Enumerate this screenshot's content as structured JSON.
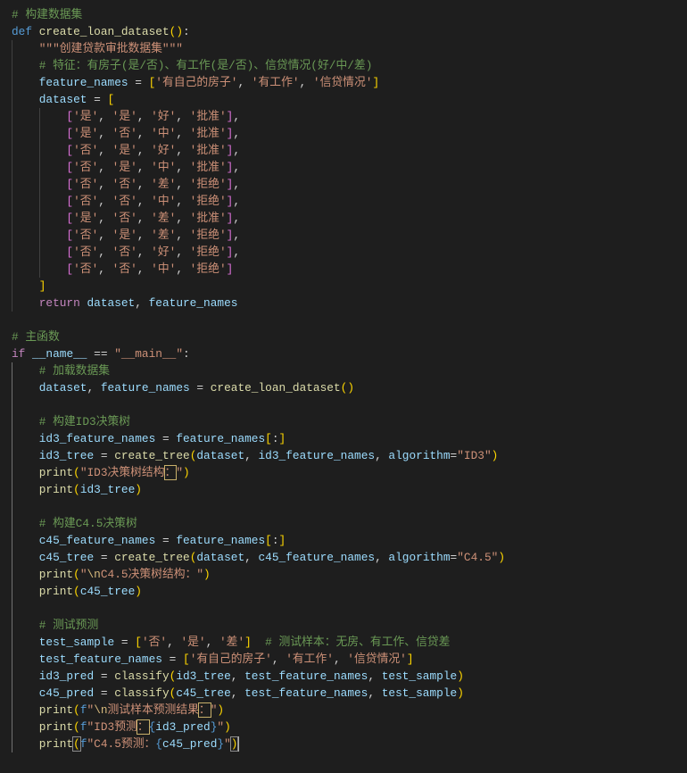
{
  "theme": {
    "background": "#1e1e1e",
    "indent_guide": "#404040",
    "indent_guide_active": "#707070",
    "cursor": "#aeafad"
  },
  "code": {
    "cursor_line": 44,
    "lines": [
      [
        [
          "# 构建数据集",
          "#6a9955"
        ]
      ],
      [
        [
          "def ",
          "#569cd6"
        ],
        [
          "create_loan_dataset",
          "#dcdcaa"
        ],
        [
          "(",
          "#ffd700"
        ],
        [
          ")",
          "#ffd700"
        ],
        [
          ":",
          "#d4d4d4"
        ]
      ],
      [
        [
          "    \"\"\"创建贷款审批数据集\"\"\"",
          "#ce9178"
        ]
      ],
      [
        [
          "    # 特征：有房子(是/否)、有工作(是/否)、信贷情况(好/中/差)",
          "#6a9955"
        ]
      ],
      [
        [
          "    feature_names",
          "#9cdcfe"
        ],
        [
          " = ",
          "#d4d4d4"
        ],
        [
          "[",
          "#ffd700"
        ],
        [
          "'有自己的房子'",
          "#ce9178"
        ],
        [
          ", ",
          "#d4d4d4"
        ],
        [
          "'有工作'",
          "#ce9178"
        ],
        [
          ", ",
          "#d4d4d4"
        ],
        [
          "'信贷情况'",
          "#ce9178"
        ],
        [
          "]",
          "#ffd700"
        ]
      ],
      [
        [
          "    dataset",
          "#9cdcfe"
        ],
        [
          " = ",
          "#d4d4d4"
        ],
        [
          "[",
          "#ffd700"
        ]
      ],
      [
        [
          "        [",
          "#da70d6"
        ],
        [
          "'是'",
          "#ce9178"
        ],
        [
          ", ",
          "#d4d4d4"
        ],
        [
          "'是'",
          "#ce9178"
        ],
        [
          ", ",
          "#d4d4d4"
        ],
        [
          "'好'",
          "#ce9178"
        ],
        [
          ", ",
          "#d4d4d4"
        ],
        [
          "'批准'",
          "#ce9178"
        ],
        [
          "]",
          "#da70d6"
        ],
        [
          ",",
          "#d4d4d4"
        ]
      ],
      [
        [
          "        [",
          "#da70d6"
        ],
        [
          "'是'",
          "#ce9178"
        ],
        [
          ", ",
          "#d4d4d4"
        ],
        [
          "'否'",
          "#ce9178"
        ],
        [
          ", ",
          "#d4d4d4"
        ],
        [
          "'中'",
          "#ce9178"
        ],
        [
          ", ",
          "#d4d4d4"
        ],
        [
          "'批准'",
          "#ce9178"
        ],
        [
          "]",
          "#da70d6"
        ],
        [
          ",",
          "#d4d4d4"
        ]
      ],
      [
        [
          "        [",
          "#da70d6"
        ],
        [
          "'否'",
          "#ce9178"
        ],
        [
          ", ",
          "#d4d4d4"
        ],
        [
          "'是'",
          "#ce9178"
        ],
        [
          ", ",
          "#d4d4d4"
        ],
        [
          "'好'",
          "#ce9178"
        ],
        [
          ", ",
          "#d4d4d4"
        ],
        [
          "'批准'",
          "#ce9178"
        ],
        [
          "]",
          "#da70d6"
        ],
        [
          ",",
          "#d4d4d4"
        ]
      ],
      [
        [
          "        [",
          "#da70d6"
        ],
        [
          "'否'",
          "#ce9178"
        ],
        [
          ", ",
          "#d4d4d4"
        ],
        [
          "'是'",
          "#ce9178"
        ],
        [
          ", ",
          "#d4d4d4"
        ],
        [
          "'中'",
          "#ce9178"
        ],
        [
          ", ",
          "#d4d4d4"
        ],
        [
          "'批准'",
          "#ce9178"
        ],
        [
          "]",
          "#da70d6"
        ],
        [
          ",",
          "#d4d4d4"
        ]
      ],
      [
        [
          "        [",
          "#da70d6"
        ],
        [
          "'否'",
          "#ce9178"
        ],
        [
          ", ",
          "#d4d4d4"
        ],
        [
          "'否'",
          "#ce9178"
        ],
        [
          ", ",
          "#d4d4d4"
        ],
        [
          "'差'",
          "#ce9178"
        ],
        [
          ", ",
          "#d4d4d4"
        ],
        [
          "'拒绝'",
          "#ce9178"
        ],
        [
          "]",
          "#da70d6"
        ],
        [
          ",",
          "#d4d4d4"
        ]
      ],
      [
        [
          "        [",
          "#da70d6"
        ],
        [
          "'否'",
          "#ce9178"
        ],
        [
          ", ",
          "#d4d4d4"
        ],
        [
          "'否'",
          "#ce9178"
        ],
        [
          ", ",
          "#d4d4d4"
        ],
        [
          "'中'",
          "#ce9178"
        ],
        [
          ", ",
          "#d4d4d4"
        ],
        [
          "'拒绝'",
          "#ce9178"
        ],
        [
          "]",
          "#da70d6"
        ],
        [
          ",",
          "#d4d4d4"
        ]
      ],
      [
        [
          "        [",
          "#da70d6"
        ],
        [
          "'是'",
          "#ce9178"
        ],
        [
          ", ",
          "#d4d4d4"
        ],
        [
          "'否'",
          "#ce9178"
        ],
        [
          ", ",
          "#d4d4d4"
        ],
        [
          "'差'",
          "#ce9178"
        ],
        [
          ", ",
          "#d4d4d4"
        ],
        [
          "'批准'",
          "#ce9178"
        ],
        [
          "]",
          "#da70d6"
        ],
        [
          ",",
          "#d4d4d4"
        ]
      ],
      [
        [
          "        [",
          "#da70d6"
        ],
        [
          "'否'",
          "#ce9178"
        ],
        [
          ", ",
          "#d4d4d4"
        ],
        [
          "'是'",
          "#ce9178"
        ],
        [
          ", ",
          "#d4d4d4"
        ],
        [
          "'差'",
          "#ce9178"
        ],
        [
          ", ",
          "#d4d4d4"
        ],
        [
          "'拒绝'",
          "#ce9178"
        ],
        [
          "]",
          "#da70d6"
        ],
        [
          ",",
          "#d4d4d4"
        ]
      ],
      [
        [
          "        [",
          "#da70d6"
        ],
        [
          "'否'",
          "#ce9178"
        ],
        [
          ", ",
          "#d4d4d4"
        ],
        [
          "'否'",
          "#ce9178"
        ],
        [
          ", ",
          "#d4d4d4"
        ],
        [
          "'好'",
          "#ce9178"
        ],
        [
          ", ",
          "#d4d4d4"
        ],
        [
          "'拒绝'",
          "#ce9178"
        ],
        [
          "]",
          "#da70d6"
        ],
        [
          ",",
          "#d4d4d4"
        ]
      ],
      [
        [
          "        [",
          "#da70d6"
        ],
        [
          "'否'",
          "#ce9178"
        ],
        [
          ", ",
          "#d4d4d4"
        ],
        [
          "'否'",
          "#ce9178"
        ],
        [
          ", ",
          "#d4d4d4"
        ],
        [
          "'中'",
          "#ce9178"
        ],
        [
          ", ",
          "#d4d4d4"
        ],
        [
          "'拒绝'",
          "#ce9178"
        ],
        [
          "]",
          "#da70d6"
        ]
      ],
      [
        [
          "    ]",
          "#ffd700"
        ]
      ],
      [
        [
          "    return ",
          "#c586c0"
        ],
        [
          "dataset",
          "#9cdcfe"
        ],
        [
          ", ",
          "#d4d4d4"
        ],
        [
          "feature_names",
          "#9cdcfe"
        ]
      ],
      [],
      [
        [
          "# 主函数",
          "#6a9955"
        ]
      ],
      [
        [
          "if ",
          "#c586c0"
        ],
        [
          "__name__",
          "#9cdcfe"
        ],
        [
          " == ",
          "#d4d4d4"
        ],
        [
          "\"__main__\"",
          "#ce9178"
        ],
        [
          ":",
          "#d4d4d4"
        ]
      ],
      [
        [
          "    # 加载数据集",
          "#6a9955"
        ]
      ],
      [
        [
          "    dataset",
          "#9cdcfe"
        ],
        [
          ", ",
          "#d4d4d4"
        ],
        [
          "feature_names",
          "#9cdcfe"
        ],
        [
          " = ",
          "#d4d4d4"
        ],
        [
          "create_loan_dataset",
          "#dcdcaa"
        ],
        [
          "(",
          "#ffd700"
        ],
        [
          ")",
          "#ffd700"
        ]
      ],
      [],
      [
        [
          "    # 构建ID3决策树",
          "#6a9955"
        ]
      ],
      [
        [
          "    id3_feature_names",
          "#9cdcfe"
        ],
        [
          " = ",
          "#d4d4d4"
        ],
        [
          "feature_names",
          "#9cdcfe"
        ],
        [
          "[",
          "#ffd700"
        ],
        [
          ":",
          "#d4d4d4"
        ],
        [
          "]",
          "#ffd700"
        ]
      ],
      [
        [
          "    id3_tree",
          "#9cdcfe"
        ],
        [
          " = ",
          "#d4d4d4"
        ],
        [
          "create_tree",
          "#dcdcaa"
        ],
        [
          "(",
          "#ffd700"
        ],
        [
          "dataset",
          "#9cdcfe"
        ],
        [
          ", ",
          "#d4d4d4"
        ],
        [
          "id3_feature_names",
          "#9cdcfe"
        ],
        [
          ", ",
          "#d4d4d4"
        ],
        [
          "algorithm",
          "#9cdcfe"
        ],
        [
          "=",
          "#d4d4d4"
        ],
        [
          "\"ID3\"",
          "#ce9178"
        ],
        [
          ")",
          "#ffd700"
        ]
      ],
      [
        [
          "    print",
          "#dcdcaa"
        ],
        [
          "(",
          "#ffd700"
        ],
        [
          "\"ID3决策树结构",
          "#ce9178"
        ],
        [
          "：",
          "#ce9178",
          "#c8b06a"
        ],
        [
          "\"",
          "#ce9178"
        ],
        [
          ")",
          "#ffd700"
        ]
      ],
      [
        [
          "    print",
          "#dcdcaa"
        ],
        [
          "(",
          "#ffd700"
        ],
        [
          "id3_tree",
          "#9cdcfe"
        ],
        [
          ")",
          "#ffd700"
        ]
      ],
      [],
      [
        [
          "    # 构建C4.5决策树",
          "#6a9955"
        ]
      ],
      [
        [
          "    c45_feature_names",
          "#9cdcfe"
        ],
        [
          " = ",
          "#d4d4d4"
        ],
        [
          "feature_names",
          "#9cdcfe"
        ],
        [
          "[",
          "#ffd700"
        ],
        [
          ":",
          "#d4d4d4"
        ],
        [
          "]",
          "#ffd700"
        ]
      ],
      [
        [
          "    c45_tree",
          "#9cdcfe"
        ],
        [
          " = ",
          "#d4d4d4"
        ],
        [
          "create_tree",
          "#dcdcaa"
        ],
        [
          "(",
          "#ffd700"
        ],
        [
          "dataset",
          "#9cdcfe"
        ],
        [
          ", ",
          "#d4d4d4"
        ],
        [
          "c45_feature_names",
          "#9cdcfe"
        ],
        [
          ", ",
          "#d4d4d4"
        ],
        [
          "algorithm",
          "#9cdcfe"
        ],
        [
          "=",
          "#d4d4d4"
        ],
        [
          "\"C4.5\"",
          "#ce9178"
        ],
        [
          ")",
          "#ffd700"
        ]
      ],
      [
        [
          "    print",
          "#dcdcaa"
        ],
        [
          "(",
          "#ffd700"
        ],
        [
          "\"",
          "#ce9178"
        ],
        [
          "\\n",
          "#d7ba7d"
        ],
        [
          "C4.5决策树结构：\"",
          "#ce9178"
        ],
        [
          ")",
          "#ffd700"
        ]
      ],
      [
        [
          "    print",
          "#dcdcaa"
        ],
        [
          "(",
          "#ffd700"
        ],
        [
          "c45_tree",
          "#9cdcfe"
        ],
        [
          ")",
          "#ffd700"
        ]
      ],
      [],
      [
        [
          "    # 测试预测",
          "#6a9955"
        ]
      ],
      [
        [
          "    test_sample",
          "#9cdcfe"
        ],
        [
          " = ",
          "#d4d4d4"
        ],
        [
          "[",
          "#ffd700"
        ],
        [
          "'否'",
          "#ce9178"
        ],
        [
          ", ",
          "#d4d4d4"
        ],
        [
          "'是'",
          "#ce9178"
        ],
        [
          ", ",
          "#d4d4d4"
        ],
        [
          "'差'",
          "#ce9178"
        ],
        [
          "]",
          "#ffd700"
        ],
        [
          "  # 测试样本：无房、有工作、信贷差",
          "#6a9955"
        ]
      ],
      [
        [
          "    test_feature_names",
          "#9cdcfe"
        ],
        [
          " = ",
          "#d4d4d4"
        ],
        [
          "[",
          "#ffd700"
        ],
        [
          "'有自己的房子'",
          "#ce9178"
        ],
        [
          ", ",
          "#d4d4d4"
        ],
        [
          "'有工作'",
          "#ce9178"
        ],
        [
          ", ",
          "#d4d4d4"
        ],
        [
          "'信贷情况'",
          "#ce9178"
        ],
        [
          "]",
          "#ffd700"
        ]
      ],
      [
        [
          "    id3_pred",
          "#9cdcfe"
        ],
        [
          " = ",
          "#d4d4d4"
        ],
        [
          "classify",
          "#dcdcaa"
        ],
        [
          "(",
          "#ffd700"
        ],
        [
          "id3_tree",
          "#9cdcfe"
        ],
        [
          ", ",
          "#d4d4d4"
        ],
        [
          "test_feature_names",
          "#9cdcfe"
        ],
        [
          ", ",
          "#d4d4d4"
        ],
        [
          "test_sample",
          "#9cdcfe"
        ],
        [
          ")",
          "#ffd700"
        ]
      ],
      [
        [
          "    c45_pred",
          "#9cdcfe"
        ],
        [
          " = ",
          "#d4d4d4"
        ],
        [
          "classify",
          "#dcdcaa"
        ],
        [
          "(",
          "#ffd700"
        ],
        [
          "c45_tree",
          "#9cdcfe"
        ],
        [
          ", ",
          "#d4d4d4"
        ],
        [
          "test_feature_names",
          "#9cdcfe"
        ],
        [
          ", ",
          "#d4d4d4"
        ],
        [
          "test_sample",
          "#9cdcfe"
        ],
        [
          ")",
          "#ffd700"
        ]
      ],
      [
        [
          "    print",
          "#dcdcaa"
        ],
        [
          "(",
          "#ffd700"
        ],
        [
          "f",
          "#569cd6"
        ],
        [
          "\"",
          "#ce9178"
        ],
        [
          "\\n",
          "#d7ba7d"
        ],
        [
          "测试样本预测结果",
          "#ce9178"
        ],
        [
          "：",
          "#ce9178",
          "#c8b06a"
        ],
        [
          "\"",
          "#ce9178"
        ],
        [
          ")",
          "#ffd700"
        ]
      ],
      [
        [
          "    print",
          "#dcdcaa"
        ],
        [
          "(",
          "#ffd700"
        ],
        [
          "f",
          "#569cd6"
        ],
        [
          "\"ID3预测",
          "#ce9178"
        ],
        [
          "：",
          "#ce9178",
          "#c8b06a"
        ],
        [
          "{",
          "#569cd6"
        ],
        [
          "id3_pred",
          "#9cdcfe"
        ],
        [
          "}",
          "#569cd6"
        ],
        [
          "\"",
          "#ce9178"
        ],
        [
          ")",
          "#ffd700"
        ]
      ],
      [
        [
          "    print",
          "#dcdcaa"
        ],
        [
          "(",
          "#ffd700",
          "#8c8c8c"
        ],
        [
          "f",
          "#569cd6"
        ],
        [
          "\"C4.5预测：",
          "#ce9178"
        ],
        [
          "{",
          "#569cd6"
        ],
        [
          "c45_pred",
          "#9cdcfe"
        ],
        [
          "}",
          "#569cd6"
        ],
        [
          "\"",
          "#ce9178"
        ],
        [
          ")",
          "#ffd700",
          "#8c8c8c"
        ]
      ]
    ]
  }
}
